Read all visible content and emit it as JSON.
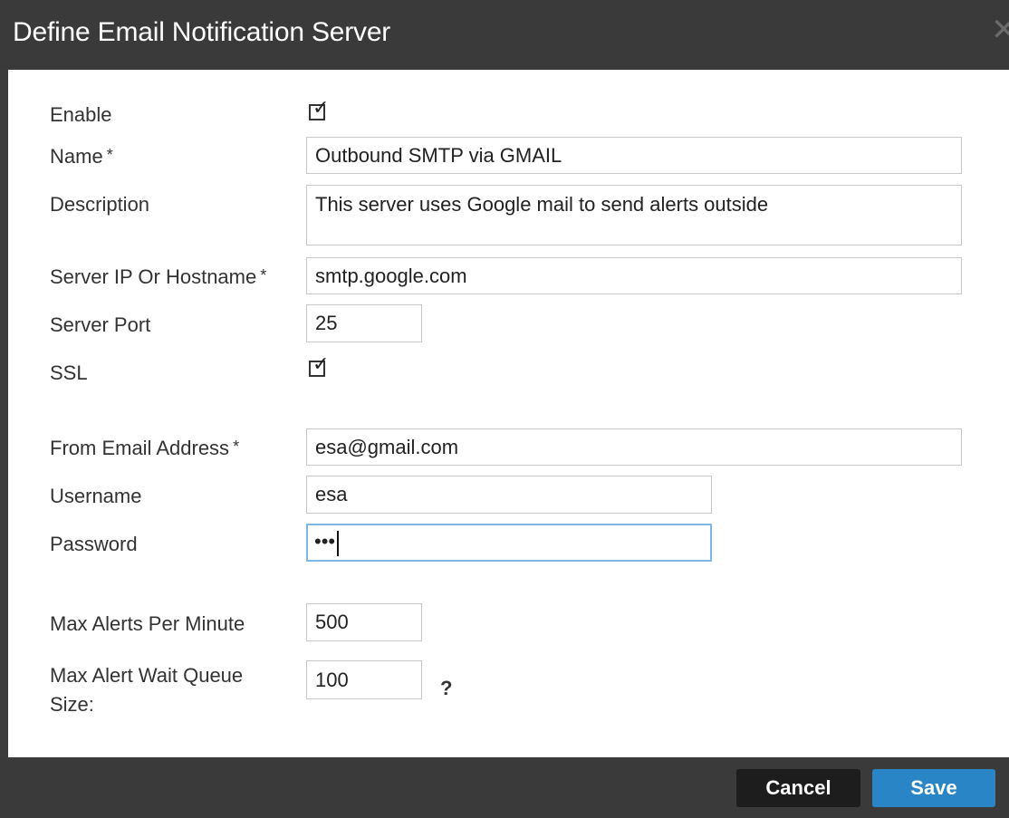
{
  "dialog": {
    "title": "Define Email Notification Server",
    "close_icon": "close-icon",
    "close_glyph": "✕"
  },
  "form": {
    "enable": {
      "label": "Enable",
      "checked": true
    },
    "name": {
      "label": "Name",
      "required": "*",
      "value": "Outbound SMTP via GMAIL"
    },
    "description": {
      "label": "Description",
      "value": "This server uses Google mail to send alerts outside"
    },
    "server": {
      "label": "Server IP Or Hostname",
      "required": "*",
      "value": "smtp.google.com"
    },
    "port": {
      "label": "Server Port",
      "value": "25"
    },
    "ssl": {
      "label": "SSL",
      "checked": true
    },
    "from_email": {
      "label": "From Email Address",
      "required": "*",
      "value": "esa@gmail.com"
    },
    "username": {
      "label": "Username",
      "value": "esa"
    },
    "password": {
      "label": "Password",
      "value": "•••"
    },
    "max_alerts": {
      "label": "Max Alerts Per Minute",
      "value": "500"
    },
    "max_queue": {
      "label_line1": "Max Alert Wait Queue",
      "label_line2": "Size:",
      "value": "100",
      "help": "?"
    }
  },
  "footer": {
    "cancel_label": "Cancel",
    "save_label": "Save"
  },
  "colors": {
    "title_bar": "#3a3a3a",
    "save_button": "#2a85c6",
    "cancel_button": "#1d1d1d",
    "focus_border": "#7fb7e2"
  }
}
